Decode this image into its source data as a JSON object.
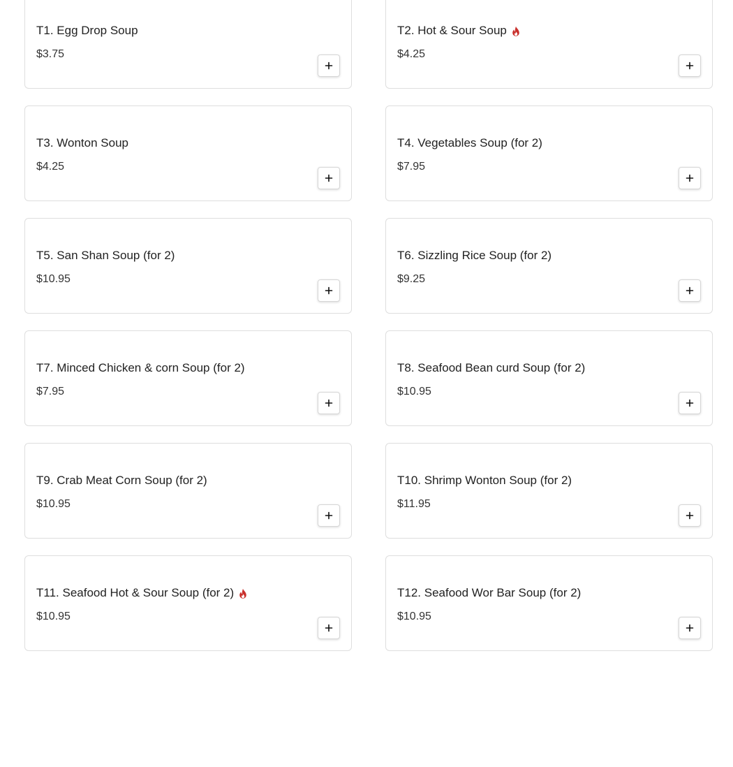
{
  "accent_color": "#c9302c",
  "items": [
    {
      "name": "T1. Egg Drop Soup",
      "price": "$3.75",
      "spicy": false,
      "add_icon": "plus-icon"
    },
    {
      "name": "T2. Hot & Sour Soup",
      "price": "$4.25",
      "spicy": true,
      "add_icon": "plus-icon"
    },
    {
      "name": "T3. Wonton Soup",
      "price": "$4.25",
      "spicy": false,
      "add_icon": "plus-icon"
    },
    {
      "name": "T4. Vegetables Soup (for 2)",
      "price": "$7.95",
      "spicy": false,
      "add_icon": "plus-icon"
    },
    {
      "name": "T5. San Shan Soup (for 2)",
      "price": "$10.95",
      "spicy": false,
      "add_icon": "plus-icon"
    },
    {
      "name": "T6. Sizzling Rice Soup (for 2)",
      "price": "$9.25",
      "spicy": false,
      "add_icon": "plus-icon"
    },
    {
      "name": "T7. Minced Chicken & corn Soup (for 2)",
      "price": "$7.95",
      "spicy": false,
      "add_icon": "plus-icon"
    },
    {
      "name": "T8. Seafood Bean curd Soup (for 2)",
      "price": "$10.95",
      "spicy": false,
      "add_icon": "plus-icon"
    },
    {
      "name": "T9. Crab Meat Corn Soup (for 2)",
      "price": "$10.95",
      "spicy": false,
      "add_icon": "plus-icon"
    },
    {
      "name": "T10. Shrimp Wonton Soup (for 2)",
      "price": "$11.95",
      "spicy": false,
      "add_icon": "plus-icon"
    },
    {
      "name": "T11. Seafood Hot & Sour Soup (for 2)",
      "price": "$10.95",
      "spicy": true,
      "add_icon": "plus-icon"
    },
    {
      "name": "T12. Seafood Wor Bar Soup (for 2)",
      "price": "$10.95",
      "spicy": false,
      "add_icon": "plus-icon"
    }
  ]
}
